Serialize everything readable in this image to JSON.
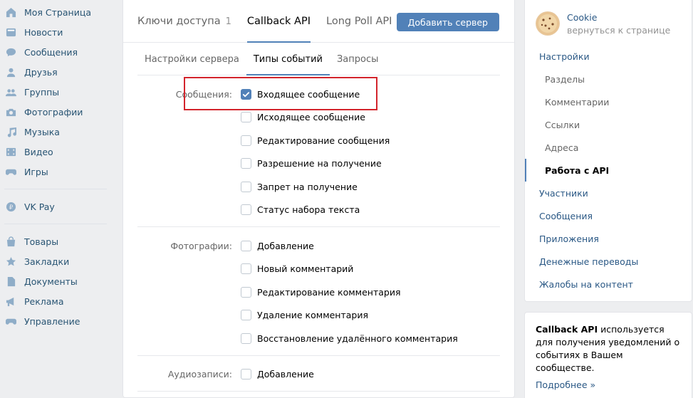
{
  "left_nav": {
    "group1": [
      {
        "label": "Моя Страница",
        "icon": "home-icon"
      },
      {
        "label": "Новости",
        "icon": "news-icon"
      },
      {
        "label": "Сообщения",
        "icon": "messages-icon"
      },
      {
        "label": "Друзья",
        "icon": "friend-icon"
      },
      {
        "label": "Группы",
        "icon": "groups-icon"
      },
      {
        "label": "Фотографии",
        "icon": "camera-icon"
      },
      {
        "label": "Музыка",
        "icon": "music-icon"
      },
      {
        "label": "Видео",
        "icon": "video-icon"
      },
      {
        "label": "Игры",
        "icon": "gamepad-icon"
      }
    ],
    "group2": [
      {
        "label": "VK Pay",
        "icon": "vkpay-icon"
      }
    ],
    "group3": [
      {
        "label": "Товары",
        "icon": "shopping-bag-icon"
      },
      {
        "label": "Закладки",
        "icon": "star-icon"
      },
      {
        "label": "Документы",
        "icon": "document-icon"
      },
      {
        "label": "Реклама",
        "icon": "megaphone-icon"
      },
      {
        "label": "Управление",
        "icon": "gamepad-icon"
      }
    ]
  },
  "main": {
    "top_tabs": [
      {
        "label": "Ключи доступа",
        "count": "1"
      },
      {
        "label": "Callback API"
      },
      {
        "label": "Long Poll API"
      }
    ],
    "add_server_label": "Добавить сервер",
    "sub_tabs": [
      "Настройки сервера",
      "Типы событий",
      "Запросы"
    ],
    "sections": [
      {
        "label": "Сообщения:",
        "options": [
          {
            "label": "Входящее сообщение",
            "checked": true
          },
          {
            "label": "Исходящее сообщение",
            "checked": false
          },
          {
            "label": "Редактирование сообщения",
            "checked": false
          },
          {
            "label": "Разрешение на получение",
            "checked": false
          },
          {
            "label": "Запрет на получение",
            "checked": false
          },
          {
            "label": "Статус набора текста",
            "checked": false
          }
        ]
      },
      {
        "label": "Фотографии:",
        "options": [
          {
            "label": "Добавление",
            "checked": false
          },
          {
            "label": "Новый комментарий",
            "checked": false
          },
          {
            "label": "Редактирование комментария",
            "checked": false
          },
          {
            "label": "Удаление комментария",
            "checked": false
          },
          {
            "label": "Восстановление удалённого комментария",
            "checked": false
          }
        ]
      },
      {
        "label": "Аудиозаписи:",
        "options": [
          {
            "label": "Добавление",
            "checked": false
          }
        ]
      }
    ]
  },
  "right": {
    "community_name": "Cookie",
    "back_link": "вернуться к странице",
    "menu": [
      {
        "label": "Настройки",
        "type": "main"
      },
      {
        "label": "Разделы",
        "type": "sub"
      },
      {
        "label": "Комментарии",
        "type": "sub"
      },
      {
        "label": "Ссылки",
        "type": "sub"
      },
      {
        "label": "Адреса",
        "type": "sub"
      },
      {
        "label": "Работа с API",
        "type": "active"
      },
      {
        "label": "Участники",
        "type": "main"
      },
      {
        "label": "Сообщения",
        "type": "main"
      },
      {
        "label": "Приложения",
        "type": "main"
      },
      {
        "label": "Денежные переводы",
        "type": "main"
      },
      {
        "label": "Жалобы на контент",
        "type": "main"
      }
    ],
    "info": {
      "bold": "Callback API",
      "text": " используется для получения уведомлений о событиях в Вашем сообществе.",
      "more": "Подробнее »"
    }
  },
  "colors": {
    "accent": "#5181b8",
    "link": "#2a5885",
    "highlight_border": "#d3242c",
    "background": "#edeef0"
  }
}
